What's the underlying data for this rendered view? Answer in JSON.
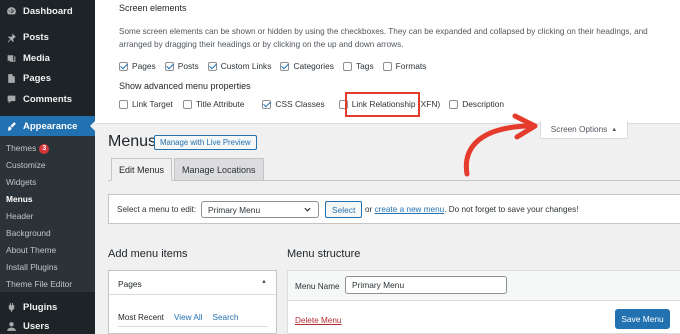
{
  "sidebar": {
    "top_items": [
      {
        "label": "Dashboard",
        "icon": "dashboard-icon"
      },
      {
        "label": "Posts",
        "icon": "pin-icon"
      },
      {
        "label": "Media",
        "icon": "media-icon"
      },
      {
        "label": "Pages",
        "icon": "page-icon"
      },
      {
        "label": "Comments",
        "icon": "comment-icon"
      },
      {
        "label": "Appearance",
        "icon": "paintbrush-icon"
      }
    ],
    "submenu": [
      {
        "label": "Themes",
        "badge": "3"
      },
      {
        "label": "Customize"
      },
      {
        "label": "Widgets"
      },
      {
        "label": "Menus"
      },
      {
        "label": "Header"
      },
      {
        "label": "Background"
      },
      {
        "label": "About Theme"
      },
      {
        "label": "Install Plugins"
      },
      {
        "label": "Theme File Editor"
      }
    ],
    "bottom_items": [
      {
        "label": "Plugins",
        "icon": "plugin-icon"
      },
      {
        "label": "Users",
        "icon": "users-icon"
      }
    ],
    "accent_color": "#2271b1"
  },
  "screen_options": {
    "heading": "Screen elements",
    "description": "Some screen elements can be shown or hidden by using the checkboxes. They can be expanded and collapsed by clicking on their headings, and arranged by dragging their headings or by clicking on the up and down arrows.",
    "elements": [
      {
        "label": "Pages",
        "checked": true
      },
      {
        "label": "Posts",
        "checked": true
      },
      {
        "label": "Custom Links",
        "checked": true
      },
      {
        "label": "Categories",
        "checked": true
      },
      {
        "label": "Tags",
        "checked": false
      },
      {
        "label": "Formats",
        "checked": false
      }
    ],
    "advanced_heading": "Show advanced menu properties",
    "advanced": [
      {
        "label": "Link Target",
        "checked": false
      },
      {
        "label": "Title Attribute",
        "checked": false
      },
      {
        "label": "CSS Classes",
        "checked": true
      },
      {
        "label": "Link Relationship (XFN)",
        "checked": false
      },
      {
        "label": "Description",
        "checked": false
      }
    ],
    "tab_label": "Screen Options",
    "highlight_color": "#e43b2c"
  },
  "page": {
    "title": "Menus",
    "preview_button": "Manage with Live Preview",
    "tabs": [
      "Edit Menus",
      "Manage Locations"
    ],
    "select_label": "Select a menu to edit:",
    "selected_menu": "Primary Menu",
    "select_button": "Select",
    "or_text": "or",
    "create_link": "create a new menu",
    "after_text": ". Do not forget to save your changes!"
  },
  "add_items": {
    "title": "Add menu items",
    "pages_heading": "Pages",
    "tabs": [
      "Most Recent",
      "View All",
      "Search"
    ]
  },
  "structure": {
    "title": "Menu structure",
    "name_label": "Menu Name",
    "name_value": "Primary Menu",
    "delete_label": "Delete Menu",
    "save_label": "Save Menu"
  }
}
